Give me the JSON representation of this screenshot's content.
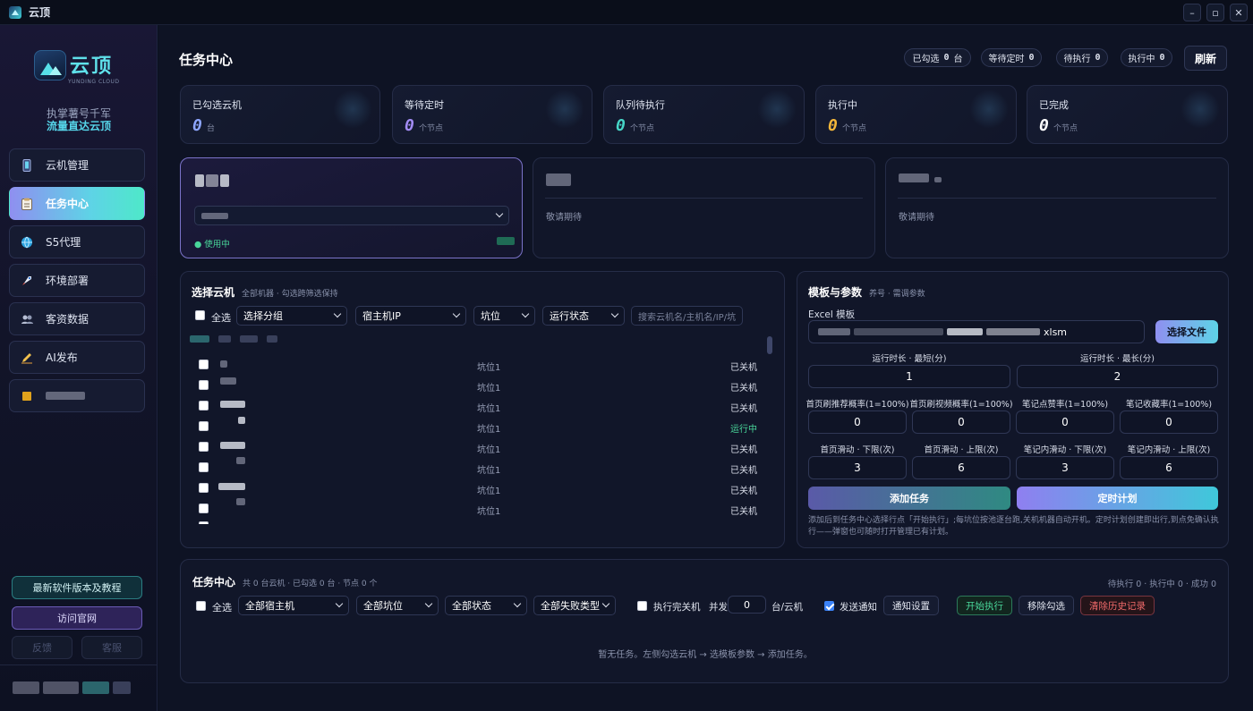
{
  "app": {
    "title": "云顶",
    "brand_name": "云顶",
    "brand_sub": "YUNDING CLOUD",
    "slogan_line1": "执掌薯号千军",
    "slogan_line2": "流量直达云顶"
  },
  "window_controls": {
    "minimize": "–",
    "maximize": "▫",
    "close": "✕"
  },
  "sidebar": {
    "items": [
      {
        "label": "云机管理",
        "icon": "phone-icon",
        "active": false
      },
      {
        "label": "任务中心",
        "icon": "clipboard-icon",
        "active": true
      },
      {
        "label": "S5代理",
        "icon": "globe-icon",
        "active": false
      },
      {
        "label": "环境部署",
        "icon": "rocket-icon",
        "active": false
      },
      {
        "label": "客资数据",
        "icon": "users-icon",
        "active": false
      },
      {
        "label": "AI发布",
        "icon": "pen-icon",
        "active": false
      }
    ],
    "latest_button": "最新软件版本及教程",
    "official_button": "访问官网",
    "feedback_button": "反馈",
    "service_button": "客服"
  },
  "header": {
    "title": "任务中心",
    "pills": [
      {
        "label": "已勾选",
        "value": "0",
        "suffix": "台"
      },
      {
        "label": "等待定时",
        "value": "0",
        "suffix": ""
      },
      {
        "label": "待执行",
        "value": "0",
        "suffix": ""
      },
      {
        "label": "执行中",
        "value": "0",
        "suffix": ""
      }
    ],
    "refresh_button": "刷新"
  },
  "stats": [
    {
      "label": "已勾选云机",
      "value": "0",
      "unit": "台",
      "color": "#8ea6ff"
    },
    {
      "label": "等待定时",
      "value": "0",
      "unit": "个节点",
      "color": "#a38cf5"
    },
    {
      "label": "队列待执行",
      "value": "0",
      "unit": "个节点",
      "color": "#46d6c8"
    },
    {
      "label": "执行中",
      "value": "0",
      "unit": "个节点",
      "color": "#f5b73a"
    },
    {
      "label": "已完成",
      "value": "0",
      "unit": "个节点",
      "color": "#ffffff"
    }
  ],
  "accounts": {
    "in_use_label": "● 使用中",
    "coming_soon": "敬请期待"
  },
  "machine_panel": {
    "title": "选择云机",
    "subtitle": "全部机器 · 勾选跨筛选保持",
    "select_all": "全选",
    "group_select": "选择分组",
    "host_select": "宿主机IP",
    "slot_select": "坑位",
    "status_select": "运行状态",
    "search_placeholder": "搜索云机名/主机名/IP/坑",
    "rows": [
      {
        "slot": "坑位1",
        "status": "已关机"
      },
      {
        "slot": "坑位1",
        "status": "已关机"
      },
      {
        "slot": "坑位1",
        "status": "已关机"
      },
      {
        "slot": "坑位1",
        "status": "运行中"
      },
      {
        "slot": "坑位1",
        "status": "已关机"
      },
      {
        "slot": "坑位1",
        "status": "已关机"
      },
      {
        "slot": "坑位1",
        "status": "已关机"
      },
      {
        "slot": "坑位1",
        "status": "已关机"
      }
    ]
  },
  "template_panel": {
    "title": "模板与参数",
    "subtitle": "养号 · 需调参数",
    "excel_label": "Excel 模板",
    "file_ext": "xlsm",
    "choose_file": "选择文件",
    "min_label": "运行时长 · 最短(分)",
    "min_value": "1",
    "max_label": "运行时长 · 最长(分)",
    "max_value": "2",
    "params_row1": [
      {
        "label": "首页刷推荐概率(1=100%)",
        "value": "0"
      },
      {
        "label": "首页刷视频概率(1=100%)",
        "value": "0"
      },
      {
        "label": "笔记点赞率(1=100%)",
        "value": "0"
      },
      {
        "label": "笔记收藏率(1=100%)",
        "value": "0"
      }
    ],
    "params_row2": [
      {
        "label": "首页滑动 · 下限(次)",
        "value": "3"
      },
      {
        "label": "首页滑动 · 上限(次)",
        "value": "6"
      },
      {
        "label": "笔记内滑动 · 下限(次)",
        "value": "3"
      },
      {
        "label": "笔记内滑动 · 上限(次)",
        "value": "6"
      }
    ],
    "add_task": "添加任务",
    "schedule": "定时计划",
    "hint": "添加后到任务中心选择行点「开始执行」;每坑位按池逐台跑,关机机器自动开机。定时计划创建即出行,到点免确认执行——弹窗也可随时打开管理已有计划。"
  },
  "task_panel": {
    "title": "任务中心",
    "subtitle": "共 0 台云机 · 已勾选 0 台 · 节点 0 个",
    "counts": "待执行 0 · 执行中 0 · 成功 0",
    "select_all": "全选",
    "host_select": "全部宿主机",
    "slot_select": "全部坑位",
    "status_select": "全部状态",
    "fail_select": "全部失败类型",
    "shutdown_after": "执行完关机",
    "concurrency_label": "并发",
    "concurrency_value": "0",
    "concurrency_unit": "台/云机",
    "send_notify": "发送通知",
    "notify_settings": "通知设置",
    "start": "开始执行",
    "remove": "移除勾选",
    "clear": "清除历史记录",
    "empty": "暂无任务。左侧勾选云机 → 选模板参数 → 添加任务。"
  }
}
